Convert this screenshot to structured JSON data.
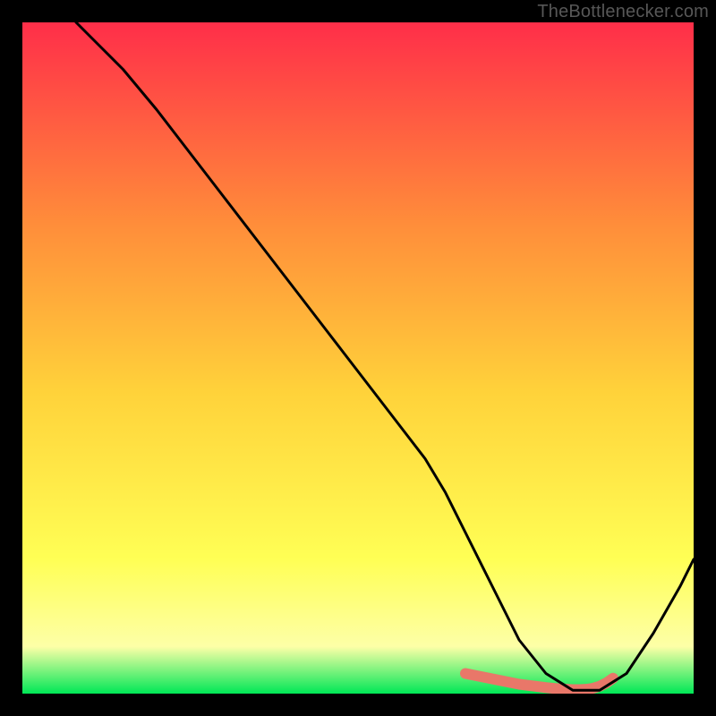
{
  "watermark": "TheBottlenecker.com",
  "chart_data": {
    "type": "line",
    "title": "",
    "xlabel": "",
    "ylabel": "",
    "xlim": [
      0,
      100
    ],
    "ylim": [
      0,
      100
    ],
    "background_gradient": {
      "top": "#ff2e49",
      "mid_upper": "#ff8d3a",
      "mid": "#ffd23a",
      "mid_lower": "#ffff55",
      "near_bottom": "#fdffa7",
      "bottom": "#00e756"
    },
    "curve": {
      "x": [
        8,
        10,
        12,
        15,
        20,
        25,
        30,
        35,
        40,
        45,
        50,
        55,
        60,
        63,
        66,
        70,
        74,
        78,
        82,
        86,
        90,
        94,
        98,
        100
      ],
      "y": [
        100,
        98,
        96,
        93,
        87,
        80.5,
        74,
        67.5,
        61,
        54.5,
        48,
        41.5,
        35,
        30,
        24,
        16,
        8,
        3,
        0.5,
        0.5,
        3,
        9,
        16,
        20
      ]
    },
    "highlight_segment": {
      "x": [
        66,
        70,
        74,
        78,
        79,
        80,
        81,
        82,
        83,
        84,
        85,
        86,
        87,
        88
      ],
      "y": [
        3,
        2.2,
        1.4,
        0.9,
        0.8,
        0.7,
        0.65,
        0.6,
        0.6,
        0.65,
        0.8,
        1.1,
        1.6,
        2.3
      ]
    },
    "highlight_color": "#e97769",
    "curve_color": "#000000"
  }
}
